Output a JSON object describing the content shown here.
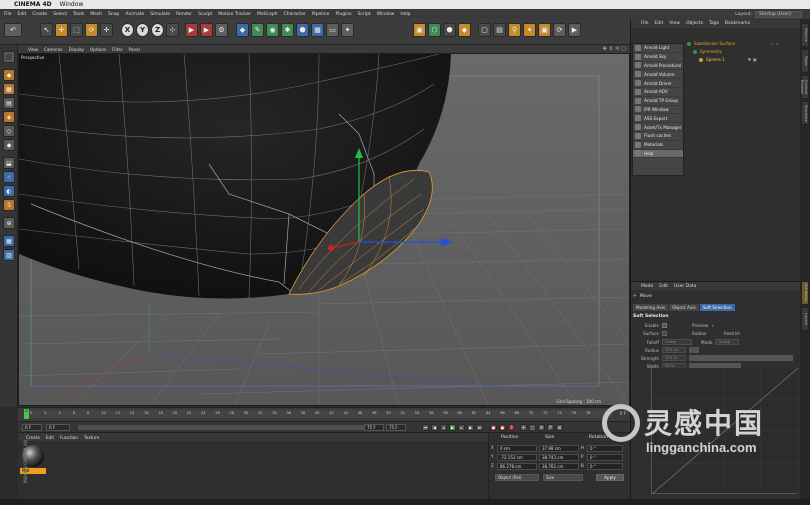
{
  "mac_menu": {
    "apple": "",
    "app": "CINEMA 4D",
    "window": "Window"
  },
  "menubar": [
    "File",
    "Edit",
    "Create",
    "Select",
    "Tools",
    "Mesh",
    "Snap",
    "Animate",
    "Simulate",
    "Render",
    "Sculpt",
    "Motion Tracker",
    "MoGraph",
    "Character",
    "Pipeline",
    "Plugins",
    "Script",
    "Window",
    "Help"
  ],
  "layout": {
    "label": "Layout:",
    "value": "Startup (User)"
  },
  "toolbar_letters": [
    "X",
    "Y",
    "Z"
  ],
  "viewport": {
    "menu": [
      "View",
      "Cameras",
      "Display",
      "Options",
      "Filter",
      "Panel"
    ],
    "label": "Perspective",
    "grid_spacing": "Grid Spacing : 100 cm"
  },
  "timeline": {
    "ticks": [
      "0",
      "2",
      "4",
      "6",
      "8",
      "10",
      "12",
      "14",
      "16",
      "18",
      "20",
      "22",
      "24",
      "26",
      "28",
      "30",
      "32",
      "34",
      "36",
      "38",
      "40",
      "42",
      "44",
      "46",
      "48",
      "50",
      "52",
      "54",
      "56",
      "58",
      "60",
      "62",
      "64",
      "66",
      "68",
      "70",
      "72",
      "74",
      "76",
      "78"
    ],
    "current_frame": "0",
    "end_label": "0 F"
  },
  "transport": {
    "start": "0 F",
    "min": "0 F",
    "max": "75 F",
    "end": "75 F"
  },
  "material_manager": {
    "menu": [
      "Create",
      "Edit",
      "Function",
      "Texture"
    ],
    "material_name": "Mat",
    "brand": "MAXON CINEMA 4D"
  },
  "coordinates": {
    "headers": [
      "Position",
      "Size",
      "Rotation"
    ],
    "rows": [
      {
        "axis": "X",
        "pos": "0 cm",
        "size": "37.98 cm",
        "rot_axis": "H",
        "rot": "0 °"
      },
      {
        "axis": "Y",
        "pos": "-72.153 cm",
        "size": "38.743 cm",
        "rot_axis": "P",
        "rot": "0 °"
      },
      {
        "axis": "Z",
        "pos": "86.278 cm",
        "size": "38.762 cm",
        "rot_axis": "B",
        "rot": "0 °"
      }
    ],
    "mode": "Object (Rel)",
    "size_mode": "Size",
    "apply": "Apply"
  },
  "right_panel": {
    "menu": [
      "File",
      "Edit",
      "View",
      "Objects",
      "Tags",
      "Bookmarks"
    ],
    "dropdown": [
      "Arnold Light",
      "Arnold Sky",
      "Arnold Procedural",
      "Arnold Volume",
      "Arnold Driver",
      "Arnold AOV",
      "Arnold TP Group",
      "IPR Window",
      "ASS Export",
      "Asset/Tx Manager",
      "Flush caches",
      "Materials",
      "Help"
    ],
    "objects": [
      {
        "name": "Subdivision Surface",
        "color": "#f0a020"
      },
      {
        "name": "Symmetry",
        "color": "#f0a020"
      },
      {
        "name": "Sphere.1",
        "color": "#f0c040"
      }
    ]
  },
  "attributes": {
    "menu": [
      "Mode",
      "Edit",
      "User Data"
    ],
    "mode_label": "Move",
    "tabs": [
      "Modeling Axis",
      "Object Axis",
      "Soft Selection"
    ],
    "section": "Soft Selection",
    "rows": [
      {
        "label": "Enable",
        "value": "",
        "extra": "Preview"
      },
      {
        "label": "Surface",
        "value": "",
        "extra": "Rubber"
      },
      {
        "label": "Falloff",
        "value": "Linear",
        "extra": "Mode"
      },
      {
        "label": "Radius",
        "value": "100 cm",
        "extra": ""
      },
      {
        "label": "Strength",
        "value": "100 %",
        "extra": ""
      },
      {
        "label": "Width",
        "value": "50 %",
        "extra": ""
      }
    ],
    "restrict": "Restrict",
    "mode_value": "Group"
  },
  "side_tabs": [
    "Objects",
    "Takes",
    "Content Browser",
    "Structure",
    "Attributes",
    "Layers"
  ],
  "watermark": {
    "title": "灵感中国",
    "url": "lingganchina.com"
  },
  "colors": {
    "accent": "#3d6ba8",
    "selection": "#f0a020",
    "axis_x": "#d02020",
    "axis_y": "#20c040",
    "axis_z": "#2050e0"
  }
}
